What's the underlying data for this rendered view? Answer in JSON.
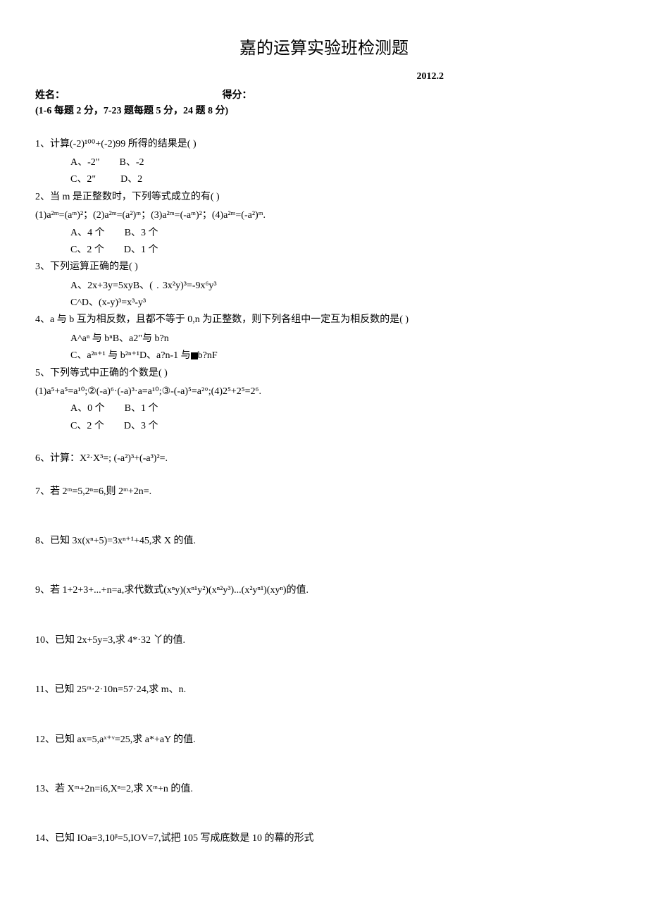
{
  "title": "嘉的运算实验班检测题",
  "date": "2012.2",
  "header": {
    "name_label": "姓名：",
    "score_label": "得分："
  },
  "scoring": "(1-6 每题 2 分，7-23 题每题 5 分，24 题 8 分)",
  "q1": {
    "stem": "1、计算(-2)¹⁰⁰+(-2)99 所得的结果是(                    )",
    "optA": "A、-2\"",
    "optB": "B、-2",
    "optC": "C、2\"",
    "optD": "D、2"
  },
  "q2": {
    "stem": "2、当 m 是正整数时，下列等式成立的有(            )",
    "sub": "(1)a²ᵐ=(aᵐ)²；(2)a²ᵐ=(a²)ᵐ；(3)a²ᵐ=(-aᵐ)²；(4)a²ᵐ=(-a²)ᵐ.",
    "optA": "A、4 个",
    "optB": "B、3 个",
    "optC": "C、2 个",
    "optD": "D、1 个"
  },
  "q3": {
    "stem": "3、下列运算正确的是(            )",
    "line1": "A、2x+3y=5xyB、(﹒3x²y)³=-9x⁶y³",
    "line2": "C^D、(x-y)³=x³-y³"
  },
  "q4": {
    "stem": "4、a 与 b 互为相反数，且都不等于 0,n 为正整数，则下列各组中一定互为相反数的是(                  )",
    "line1": "A^aⁿ 与 bⁿB、a2\"与 b?n",
    "line2_a": "C、a²ⁿ⁺¹ 与 b²ⁿ⁺¹D、a?n-1 与",
    "line2_b": "b?nF"
  },
  "q5": {
    "stem": "5、下列等式中正确的个数是(            )",
    "sub": "(1)a⁵+a⁵=a¹⁰;②(-a)⁶·(-a)³·a=a¹⁰;③-(-a)⁵=a²°;(4)2⁵+2⁵=2⁶.",
    "optA": "A、0 个",
    "optB": "B、1 个",
    "optC": "C、2 个",
    "optD": "D、3 个"
  },
  "q6": "6、计算：X²·X³=;  (-a²)³+(-a³)²=.",
  "q7": "7、若 2ᵐ=5,2ⁿ=6,则 2ᵐ+2n=.",
  "q8": "8、已知 3x(xⁿ+5)=3xⁿ⁺¹+45,求 X 的值.",
  "q9": "9、若 1+2+3+...+n=a,求代数式(xⁿy)(xⁿ¹y²)(xⁿ²y³)...(x²yⁿ¹)(xyⁿ)的值.",
  "q10": "10、已知 2x+5y=3,求 4*·32 丫的值.",
  "q11": "11、已知 25ᵐ·2·10n=57·24,求 m、n.",
  "q12": "12、已知 ax=5,aˣ⁺ᵛ=25,求 a*+aY 的值.",
  "q13": "13、若 Xᵐ+2n=i6,Xⁿ=2,求 Xᵐ+n 的值.",
  "q14": "14、已知 IOa=3,10ᵝ=5,IOV=7,试把 105 写成底数是 10 的幕的形式"
}
